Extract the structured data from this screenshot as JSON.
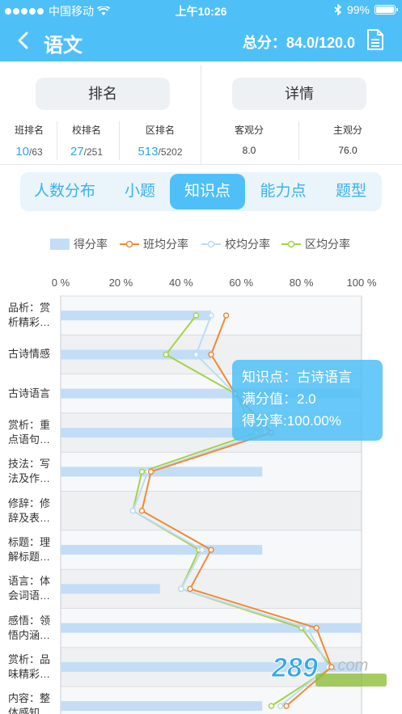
{
  "status_bar": {
    "carrier": "中国移动",
    "time": "上午10:26",
    "battery": "99%"
  },
  "nav": {
    "title": "语文",
    "total_label": "总分：84.0/120.0"
  },
  "rank": {
    "left_button": "排名",
    "right_button": "详情",
    "stats": [
      {
        "label": "班排名",
        "value": "10",
        "total": "/63"
      },
      {
        "label": "校排名",
        "value": "27",
        "total": "/251"
      },
      {
        "label": "区排名",
        "value": "513",
        "total": "/5202"
      },
      {
        "label": "客观分",
        "value": "8.0"
      },
      {
        "label": "主观分",
        "value": "76.0"
      }
    ]
  },
  "tabs": [
    "人数分布",
    "小题",
    "知识点",
    "能力点",
    "题型"
  ],
  "active_tab": "知识点",
  "legend": {
    "score_rate": "得分率",
    "class_avg": "班均分率",
    "school_avg": "校均分率",
    "district_avg": "区均分率"
  },
  "colors": {
    "accent": "#4fc0f7",
    "bar": "#c3ddf7",
    "class_line": "#f08a36",
    "school_line": "#bcdcf4",
    "district_line": "#a6d24a"
  },
  "tooltip": {
    "line1": "知识点：古诗语言",
    "line2": "满分值：2.0",
    "line3": "得分率:100.00%"
  },
  "watermark": "289.com",
  "chart_data": {
    "type": "bar",
    "orientation": "horizontal",
    "x_ticks": [
      "0 %",
      "20 %",
      "40 %",
      "60 %",
      "80 %",
      "100 %"
    ],
    "xlim": [
      0,
      100
    ],
    "categories": [
      "品析：赏析精彩…",
      "古诗情感",
      "古诗语言",
      "赏析：重点语句…",
      "技法：写法及作…",
      "修辞：修辞及表…",
      "标题：理解标题…",
      "语言：体会词语…",
      "感悟：领悟内涵…",
      "赏析：品味精彩…",
      "内容：整体感知…"
    ],
    "series": [
      {
        "name": "得分率",
        "type": "bar",
        "values": [
          50,
          50,
          100,
          67,
          67,
          0,
          67,
          33,
          100,
          100,
          67
        ]
      },
      {
        "name": "班均分率",
        "type": "line",
        "values": [
          55,
          50,
          58,
          70,
          30,
          27,
          50,
          43,
          85,
          90,
          75
        ]
      },
      {
        "name": "校均分率",
        "type": "line",
        "values": [
          50,
          45,
          58,
          68,
          29,
          24,
          47,
          40,
          82,
          89,
          73
        ]
      },
      {
        "name": "区均分率",
        "type": "line",
        "values": [
          45,
          35,
          58,
          65,
          27,
          24,
          46,
          40,
          80,
          90,
          70
        ]
      }
    ]
  }
}
